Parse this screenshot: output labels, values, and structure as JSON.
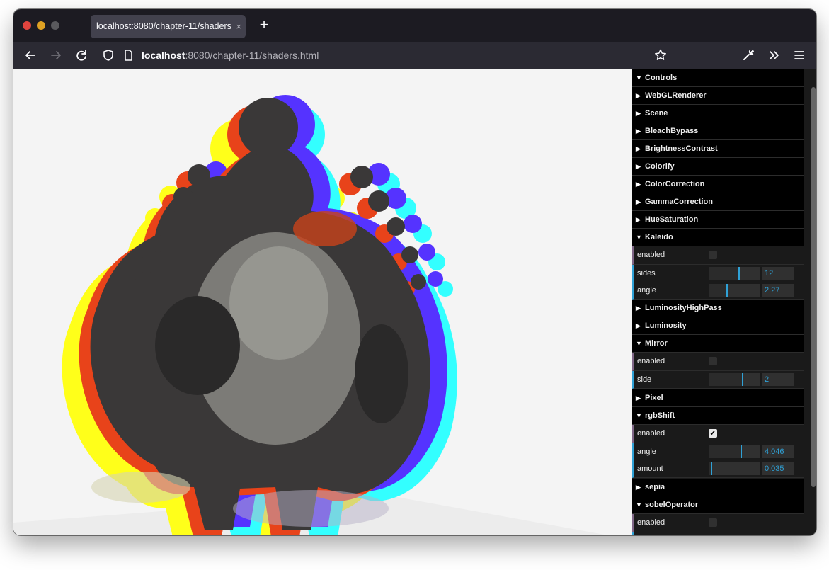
{
  "browser": {
    "tab_title": "localhost:8080/chapter-11/shaders",
    "tab_close": "×",
    "new_tab": "+",
    "url_host": "localhost",
    "url_rest": ":8080/chapter-11/shaders.html",
    "icons": [
      "back-arrow-icon",
      "forward-arrow-icon",
      "reload-icon",
      "shield-icon",
      "page-icon",
      "bookmark-star-icon",
      "wrench-icon",
      "overflow-chevrons-icon",
      "hamburger-menu-icon"
    ]
  },
  "gui": {
    "controls": "Controls",
    "folders": {
      "webgl": "WebGLRenderer",
      "scene": "Scene",
      "bleach": "BleachBypass",
      "brightness": "BrightnessContrast",
      "colorify": "Colorify",
      "colorcorr": "ColorCorrection",
      "gamma": "GammaCorrection",
      "hue": "HueSaturation",
      "kaleido": "Kaleido",
      "lumhigh": "LuminosityHighPass",
      "luminosity": "Luminosity",
      "mirror": "Mirror",
      "pixel": "Pixel",
      "rgbshift": "rgbShift",
      "sepia": "sepia",
      "sobel": "sobelOperator"
    },
    "kaleido": {
      "enabled_label": "enabled",
      "enabled": false,
      "sides_label": "sides",
      "sides": "12",
      "sides_fraction": 0.6,
      "angle_label": "angle",
      "angle": "2.27",
      "angle_fraction": 0.36
    },
    "mirror": {
      "enabled_label": "enabled",
      "enabled": false,
      "side_label": "side",
      "side": "2",
      "side_fraction": 0.67
    },
    "rgbshift": {
      "enabled_label": "enabled",
      "enabled": true,
      "check": "✔",
      "angle_label": "angle",
      "angle": "4.046",
      "angle_fraction": 0.64,
      "amount_label": "amount",
      "amount": "0.035",
      "amount_fraction": 0.05
    },
    "sobel": {
      "enabled_label": "enabled",
      "enabled": false
    }
  },
  "colors": {
    "accent": "#2fa1d6",
    "shift_yellow": "#ffff00",
    "shift_cyan": "#33ffff",
    "shift_blue": "#5533ff",
    "shift_orange": "#e8431a"
  }
}
